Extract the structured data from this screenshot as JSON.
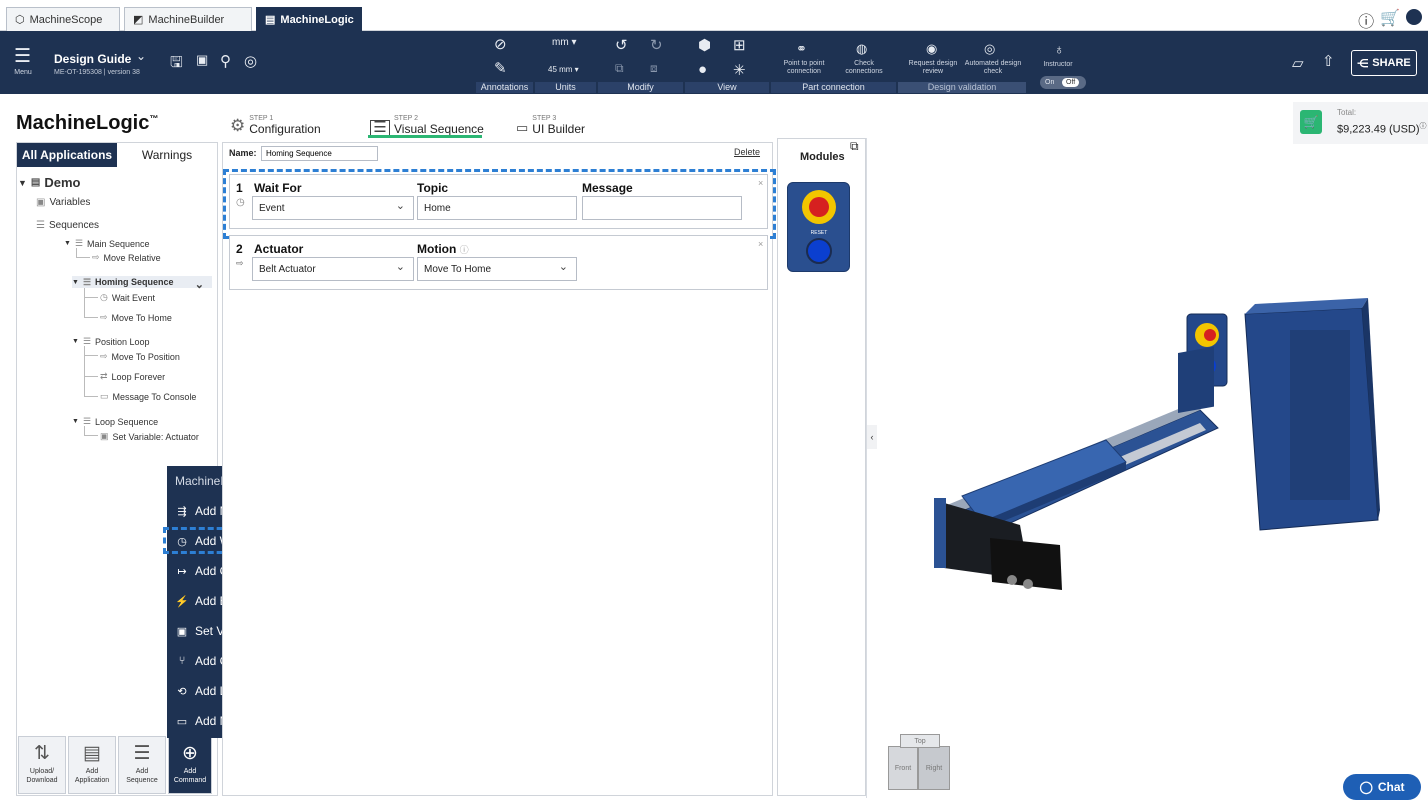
{
  "tabs": [
    {
      "label": "MachineScope",
      "icon": "hexagon-icon"
    },
    {
      "label": "MachineBuilder",
      "icon": "cube-icon"
    },
    {
      "label": "MachineLogic",
      "icon": "logic-icon"
    }
  ],
  "toolbar": {
    "menu_label": "Menu",
    "design_title": "Design Guide",
    "design_sub": "ME-OT-195308 | version 38",
    "units_top": "mm",
    "units_bottom": "45 mm",
    "groups": {
      "annotations": "Annotations",
      "units": "Units",
      "modify": "Modify",
      "view": "View",
      "part_connection": "Part connection",
      "design_validation": "Design validation"
    },
    "point_to_point": "Point to point connection",
    "check_connections": "Check connections",
    "request_review": "Request design review",
    "automated_check": "Automated design check",
    "instructor": "Instructor",
    "toggle_on": "On",
    "toggle_off": "Off",
    "share": "SHARE"
  },
  "brand": "MachineLogic",
  "steps": [
    {
      "num": "STEP 1",
      "label": "Configuration"
    },
    {
      "num": "STEP 2",
      "label": "Visual Sequence"
    },
    {
      "num": "STEP 3",
      "label": "UI Builder"
    }
  ],
  "left": {
    "tab_all": "All Applications",
    "tab_warnings": "Warnings",
    "tree": {
      "demo": "Demo",
      "variables": "Variables",
      "sequences": "Sequences",
      "main_sequence": "Main Sequence",
      "move_relative": "Move Relative",
      "homing_sequence": "Homing Sequence",
      "wait_event": "Wait Event",
      "move_to_home": "Move To Home",
      "position_loop": "Position Loop",
      "move_to_position": "Move To Position",
      "loop_forever": "Loop Forever",
      "message_to_console": "Message To Console",
      "loop_sequence": "Loop Sequence",
      "set_variable_actuator": "Set Variable: Actuator"
    },
    "bottom": {
      "upload_a": "Upload/",
      "upload_b": "Download",
      "add_app_a": "Add",
      "add_app_b": "Application",
      "add_seq_a": "Add",
      "add_seq_b": "Sequence",
      "add_cmd_a": "Add",
      "add_cmd_b": "Command"
    }
  },
  "commands": {
    "title": "MachineMotion Commands",
    "items": [
      "Add Motion",
      "Add Wait",
      "Add Output",
      "Add Execution",
      "Set Variable",
      "Add Condition",
      "Add Loop",
      "Add Message"
    ]
  },
  "center": {
    "name_label": "Name:",
    "name_value": "Homing Sequence",
    "delete": "Delete",
    "card1": {
      "num": "1",
      "title": "Wait For",
      "topic_label": "Topic",
      "message_label": "Message",
      "select_value": "Event",
      "topic_value": "Home",
      "message_value": ""
    },
    "card2": {
      "num": "2",
      "title": "Actuator",
      "motion_label": "Motion",
      "select_value": "Belt Actuator",
      "motion_value": "Move To Home"
    }
  },
  "modules": {
    "title": "Modules",
    "reset_label": "RESET"
  },
  "right": {
    "total_label": "Total:",
    "total_value": "$9,223.49 (USD)",
    "cube_front": "Front",
    "cube_right": "Right",
    "cube_top": "Top",
    "chat": "Chat"
  },
  "colors": {
    "navy": "#1e3252",
    "accent_green": "#2bb673",
    "highlight_blue": "#2d7fd4",
    "chat_blue": "#1e5fb5",
    "machine_blue": "#2a4f8f"
  }
}
